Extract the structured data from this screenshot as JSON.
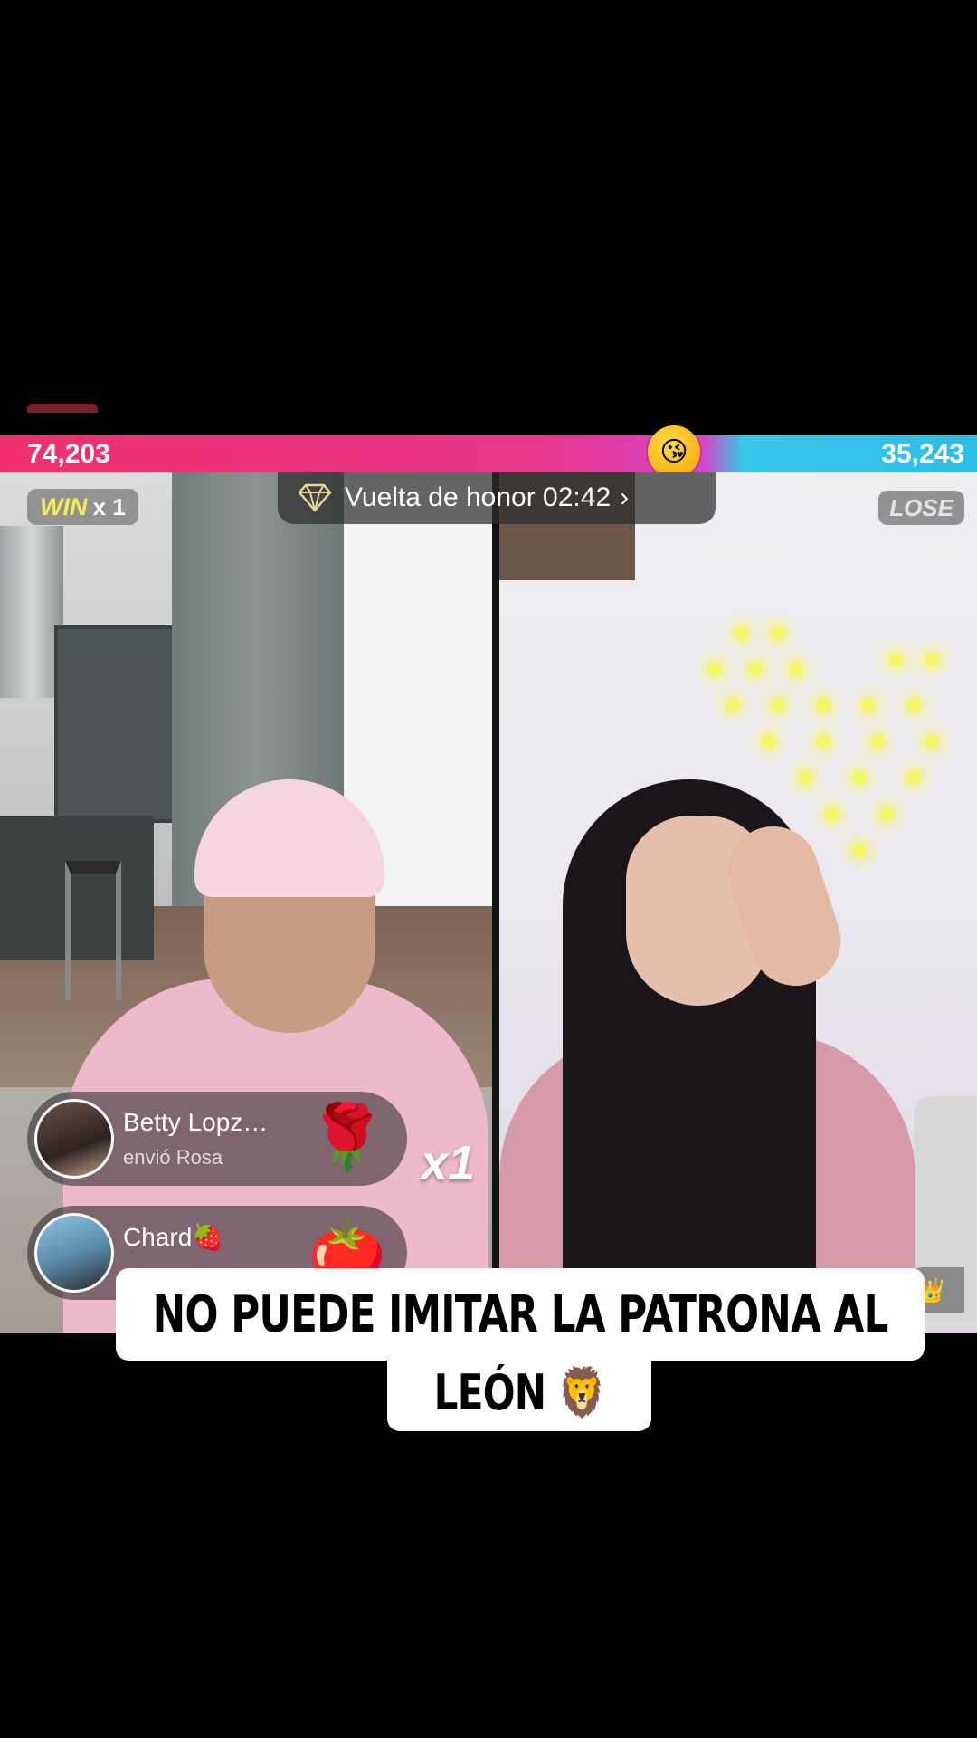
{
  "battle": {
    "left_score": "74,203",
    "right_score": "35,243",
    "left_color": "#f0306e",
    "right_color": "#2fbde6",
    "center_icon": "kiss-face-emoji"
  },
  "left_stream": {
    "result_label": "WIN",
    "result_count": "x 1",
    "result_color": "#f4ec5a"
  },
  "right_stream": {
    "result_label": "LOSE"
  },
  "honor_banner": {
    "icon": "diamond-crown-icon",
    "text": "Vuelta de honor 02:42",
    "chevron": "›"
  },
  "gifts": [
    {
      "user": "Betty Lopz…",
      "action": "envió Rosa",
      "gift_icon": "rose",
      "multiplier": "x1"
    },
    {
      "user": "Chard🍓",
      "action": "",
      "gift_icon": "character"
    }
  ],
  "caption": {
    "line1": "NO PUEDE IMITAR LA PATRONA AL",
    "line2": "LEÓN 🦁"
  }
}
